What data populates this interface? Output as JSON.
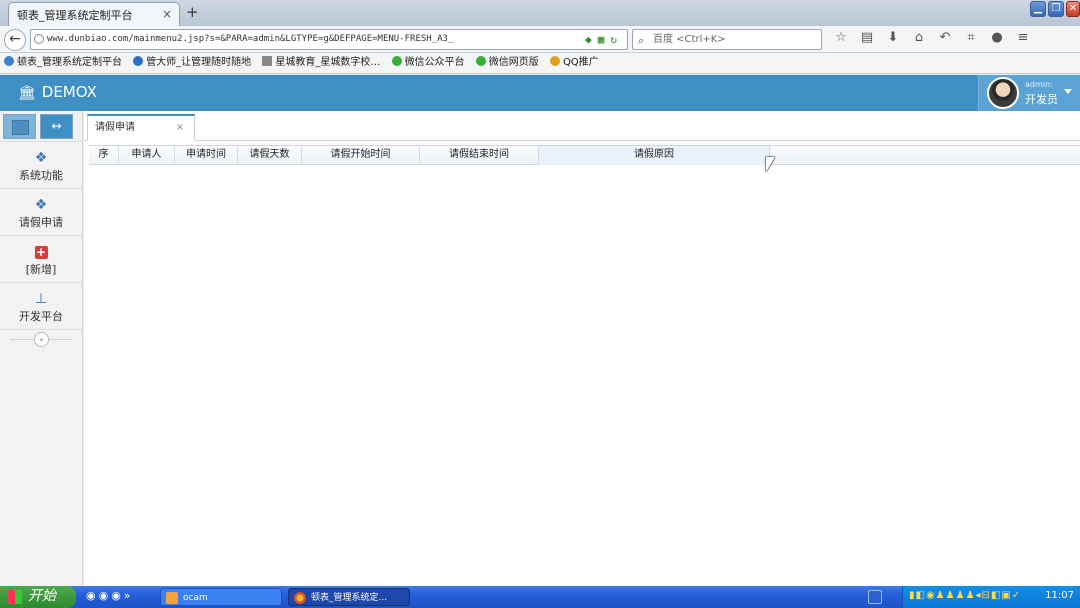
{
  "browser": {
    "tab_title": "顿表_管理系统定制平台",
    "tab_close": "×",
    "new_tab": "+",
    "window_controls": {
      "minimize": "▁",
      "restore": "❐",
      "close": "✕"
    },
    "url": "www.dunbiao.com/mainmenu2.jsp?s=&PARA=admin&LGTYPE=g&DEFPAGE=MENU-FRESH_A3_",
    "search_placeholder": "百度 <Ctrl+K>",
    "bookmarks": [
      {
        "label": "顿表_管理系统定制平台",
        "color": "#3a7fd0"
      },
      {
        "label": "管大师_让管理随时随地",
        "color": "#2a6fc8"
      },
      {
        "label": "星城教育_星城数字校…",
        "color": "#888888"
      },
      {
        "label": "微信公众平台",
        "color": "#38b038"
      },
      {
        "label": "微信网页版",
        "color": "#38b038"
      },
      {
        "label": "QQ推广",
        "color": "#e0a020"
      }
    ]
  },
  "app": {
    "logo": "DEMOX",
    "user": {
      "name": "admin:",
      "role": "开发员"
    },
    "sidebar": {
      "top_button_2": "↔",
      "items": [
        {
          "label": "系统功能",
          "icon": "cubes-icon"
        },
        {
          "label": "请假申请",
          "icon": "cubes-icon"
        },
        {
          "label": "[新增]",
          "icon": "plus-square-icon"
        },
        {
          "label": "开发平台",
          "icon": "sitemap-icon"
        }
      ],
      "collapse": "«"
    },
    "tabs": [
      {
        "label": "请假申请",
        "close": "×"
      }
    ],
    "table": {
      "columns": [
        "序",
        "申请人",
        "申请时间",
        "请假天数",
        "请假开始时间",
        "请假结束时间",
        "请假原因"
      ]
    }
  },
  "taskbar": {
    "start": "开始",
    "tasks": [
      {
        "label": "ocam"
      },
      {
        "label": "顿表_管理系统定..."
      }
    ],
    "clock": "11:07"
  },
  "colors": {
    "primary": "#3f8fc4",
    "sidebar": "#f2f2f2"
  }
}
